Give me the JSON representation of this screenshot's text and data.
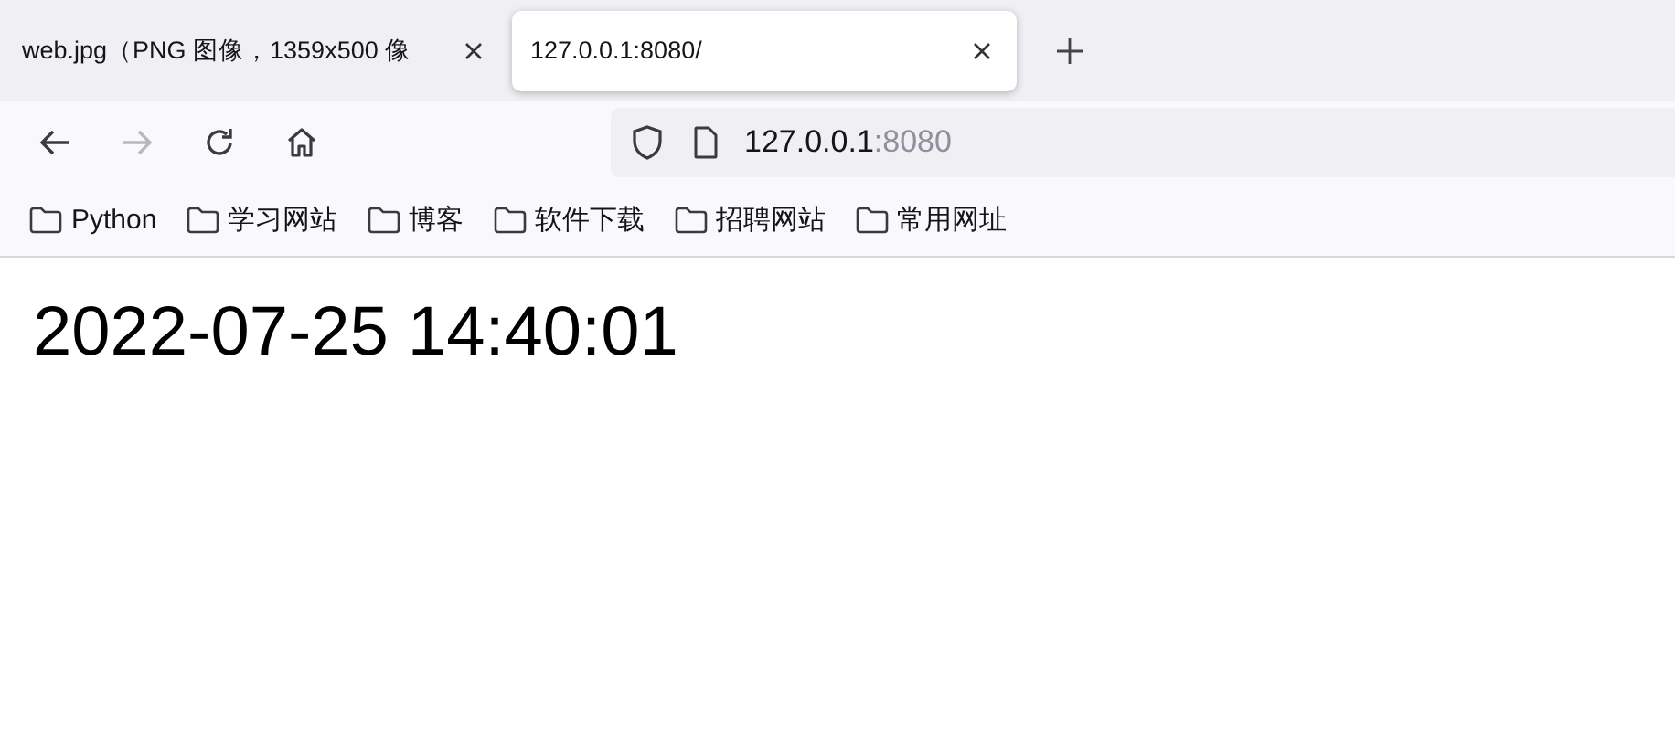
{
  "tabs": [
    {
      "title": "web.jpg（PNG 图像，1359x500 像",
      "selected": false
    },
    {
      "title": "127.0.0.1:8080/",
      "selected": true
    }
  ],
  "toolbar": {
    "back_disabled": false,
    "forward_disabled": true
  },
  "address_bar": {
    "host": "127.0.0.1",
    "port": ":8080"
  },
  "bookmarks": [
    {
      "label": "Python"
    },
    {
      "label": "学习网站"
    },
    {
      "label": "博客"
    },
    {
      "label": "软件下载"
    },
    {
      "label": "招聘网站"
    },
    {
      "label": "常用网址"
    }
  ],
  "page": {
    "text": "2022-07-25 14:40:01"
  }
}
